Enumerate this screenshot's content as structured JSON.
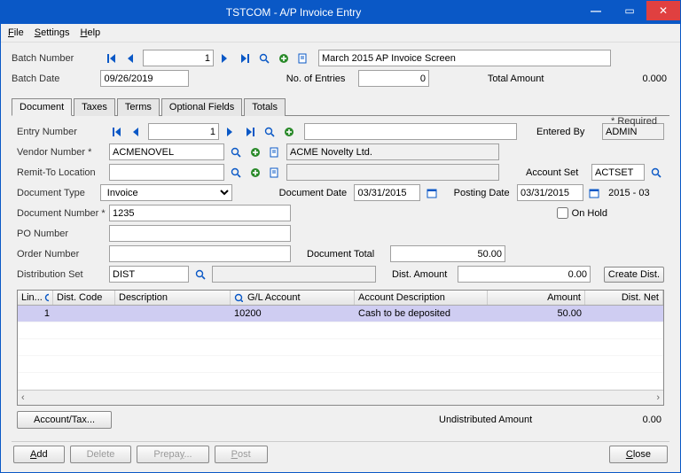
{
  "window": {
    "title": "TSTCOM - A/P Invoice Entry"
  },
  "menu": {
    "file": "File",
    "settings": "Settings",
    "help": "Help"
  },
  "batch": {
    "number_label": "Batch Number",
    "number": "1",
    "desc": "March 2015 AP Invoice Screen",
    "date_label": "Batch Date",
    "date": "09/26/2019",
    "entries_label": "No. of Entries",
    "entries": "0",
    "total_label": "Total Amount",
    "total": "0.000"
  },
  "tabs": {
    "t0": "Document",
    "t1": "Taxes",
    "t2": "Terms",
    "t3": "Optional Fields",
    "t4": "Totals",
    "required": "* Required"
  },
  "doc": {
    "entry_label": "Entry Number",
    "entry": "1",
    "entered_by_label": "Entered By",
    "entered_by": "ADMIN",
    "vendor_label": "Vendor Number *",
    "vendor": "ACMENOVEL",
    "vendor_name": "ACME Novelty Ltd.",
    "remit_label": "Remit-To Location",
    "remit": "",
    "acct_set_label": "Account Set",
    "acct_set": "ACTSET",
    "type_label": "Document Type",
    "type": "Invoice",
    "docdate_label": "Document Date",
    "docdate": "03/31/2015",
    "postdate_label": "Posting Date",
    "postdate": "03/31/2015",
    "period": "2015 - 03",
    "docnum_label": "Document Number *",
    "docnum": "1235",
    "onhold_label": "On Hold",
    "po_label": "PO Number",
    "po": "",
    "order_label": "Order Number",
    "order": "",
    "doctotal_label": "Document Total",
    "doctotal": "50.00",
    "distset_label": "Distribution Set",
    "distset": "DIST",
    "distamt_label": "Dist. Amount",
    "distamt": "0.00",
    "create_dist": "Create Dist.",
    "undist_label": "Undistributed Amount",
    "undist": "0.00",
    "accttax": "Account/Tax..."
  },
  "grid": {
    "h0": "Lin...",
    "h1": "Dist. Code",
    "h2": "Description",
    "h3": "G/L Account",
    "h4": "Account Description",
    "h5": "Amount",
    "h6": "Dist. Net",
    "r0": {
      "line": "1",
      "dist": "",
      "desc": "",
      "gl": "10200",
      "acct": "Cash to be deposited",
      "amt": "50.00",
      "net": ""
    }
  },
  "footer": {
    "add": "Add",
    "delete": "Delete",
    "prepay": "Prepay...",
    "post": "Post",
    "close": "Close"
  }
}
